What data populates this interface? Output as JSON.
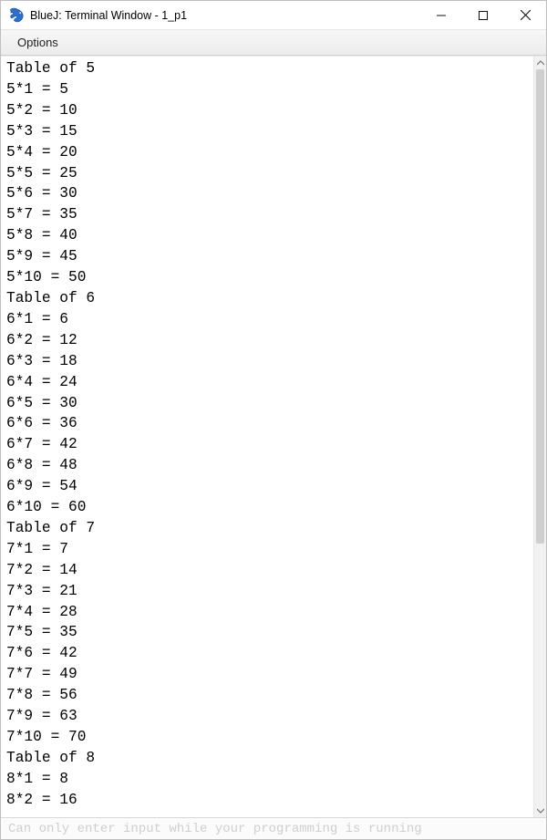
{
  "window": {
    "title": "BlueJ: Terminal Window - 1_p1"
  },
  "menubar": {
    "options": "Options"
  },
  "terminal": {
    "lines": [
      "Table of 5",
      "5*1 = 5",
      "5*2 = 10",
      "5*3 = 15",
      "5*4 = 20",
      "5*5 = 25",
      "5*6 = 30",
      "5*7 = 35",
      "5*8 = 40",
      "5*9 = 45",
      "5*10 = 50",
      "Table of 6",
      "6*1 = 6",
      "6*2 = 12",
      "6*3 = 18",
      "6*4 = 24",
      "6*5 = 30",
      "6*6 = 36",
      "6*7 = 42",
      "6*8 = 48",
      "6*9 = 54",
      "6*10 = 60",
      "Table of 7",
      "7*1 = 7",
      "7*2 = 14",
      "7*3 = 21",
      "7*4 = 28",
      "7*5 = 35",
      "7*6 = 42",
      "7*7 = 49",
      "7*8 = 56",
      "7*9 = 63",
      "7*10 = 70",
      "Table of 8",
      "8*1 = 8",
      "8*2 = 16"
    ]
  },
  "statusbar": {
    "hint": "Can only enter input while your programming is running"
  }
}
